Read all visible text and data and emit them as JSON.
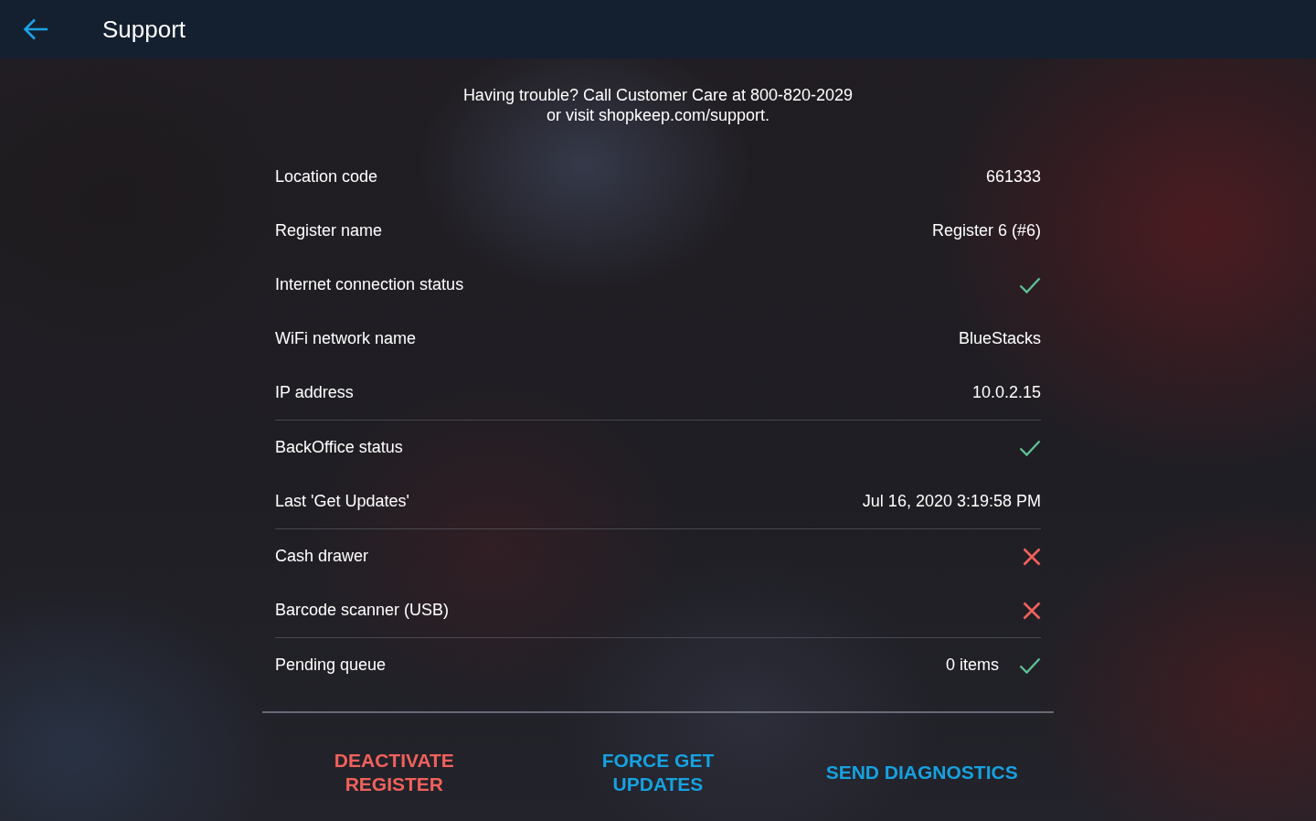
{
  "header": {
    "title": "Support"
  },
  "notice": [
    "Having trouble? Call Customer Care at 800-820-2029",
    "or visit shopkeep.com/support."
  ],
  "sections": [
    {
      "rows": [
        {
          "label": "Location code",
          "value": "661333"
        },
        {
          "label": "Register name",
          "value": "Register 6 (#6)"
        },
        {
          "label": "Internet connection status",
          "ok": true
        },
        {
          "label": "WiFi network name",
          "value": "BlueStacks"
        },
        {
          "label": "IP address",
          "value": "10.0.2.15"
        }
      ]
    },
    {
      "rows": [
        {
          "label": "BackOffice status",
          "ok": true
        },
        {
          "label": "Last 'Get Updates'",
          "value": "Jul 16, 2020 3:19:58 PM"
        }
      ]
    },
    {
      "rows": [
        {
          "label": "Cash drawer",
          "ok": false
        },
        {
          "label": "Barcode scanner (USB)",
          "ok": false
        }
      ]
    },
    {
      "rows": [
        {
          "label": "Pending queue",
          "value": "0 items",
          "ok": true
        }
      ]
    }
  ],
  "actions": [
    {
      "label": "DEACTIVATE REGISTER",
      "kind": "destructive"
    },
    {
      "label": "FORCE GET UPDATES",
      "kind": "primary"
    },
    {
      "label": "SEND DIAGNOSTICS",
      "kind": "primary"
    }
  ]
}
